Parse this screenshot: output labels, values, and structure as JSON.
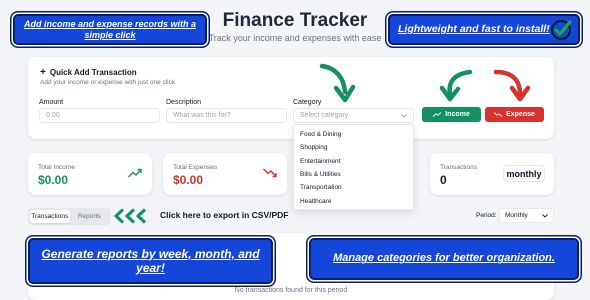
{
  "header": {
    "title": "Finance Tracker",
    "subtitle": "Track your income and expenses with ease"
  },
  "promos": {
    "quick_add": "Add income and expense records with a simple click",
    "install": "Lightweight and fast to install!",
    "reports": "Generate reports by week, month, and year!",
    "categories": "Manage categories for better organization."
  },
  "quick_add": {
    "title": "Quick Add Transaction",
    "description": "Add your income or expense with just one click",
    "amount_label": "Amount",
    "amount_placeholder": "0.00",
    "description_label": "Description",
    "description_placeholder": "What was this for?",
    "category_label": "Category",
    "category_placeholder": "Select category",
    "income_button": "Income",
    "expense_button": "Expense"
  },
  "category_options": [
    "Food & Dining",
    "Shopping",
    "Entertainment",
    "Bills & Utilities",
    "Transportation",
    "Healthcare"
  ],
  "stats": {
    "total_income_label": "Total Income",
    "total_income_value": "$0.00",
    "total_expenses_label": "Total Expenses",
    "total_expenses_value": "$0.00",
    "transactions_label": "Transactions",
    "transactions_value": "0",
    "period_pill": "monthly"
  },
  "tabs": {
    "transactions": "Transactions",
    "reports": "Reports"
  },
  "export_note": "Click here to export in CSV/PDF",
  "period": {
    "label": "Period:",
    "value": "Monthly"
  },
  "empty_message": "No transactions found for this period",
  "icons": {
    "plus": "plus-icon",
    "chevron_down": "chevron-down-icon",
    "trend_up": "trend-up-icon",
    "trend_down": "trend-down-icon",
    "check": "check-circle-icon"
  },
  "colors": {
    "income": "#149062",
    "expense": "#d8322f",
    "promo_blue": "#1446d9",
    "arrow_green": "#149062",
    "arrow_red": "#d8322f"
  }
}
